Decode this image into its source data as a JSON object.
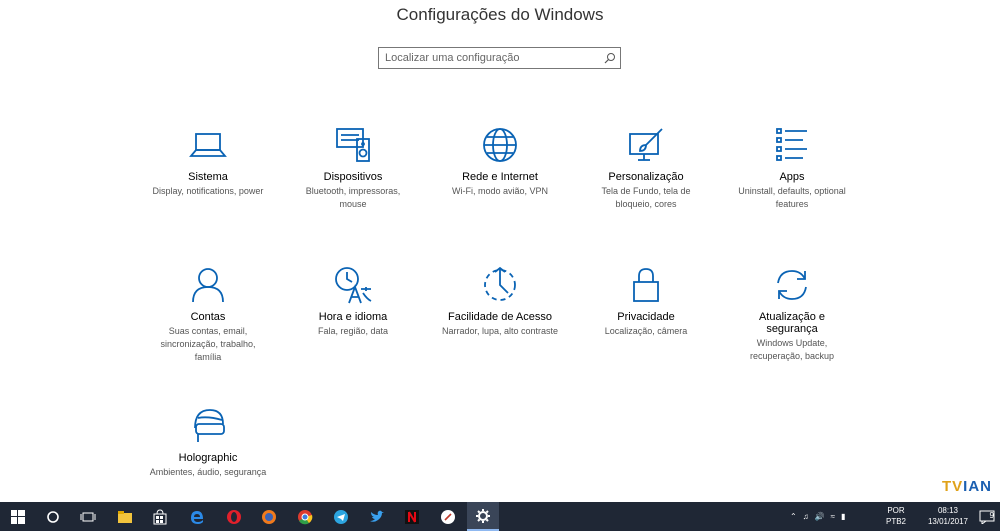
{
  "window": {
    "title": "Configurações do Windows"
  },
  "search": {
    "placeholder": "Localizar uma configuração"
  },
  "tiles": [
    {
      "name": "Sistema",
      "desc": "Display, notifications, power",
      "icon": "laptop-icon"
    },
    {
      "name": "Dispositivos",
      "desc": "Bluetooth, impressoras, mouse",
      "icon": "keyboard-speaker-icon"
    },
    {
      "name": "Rede e Internet",
      "desc": "Wi-Fi, modo avião, VPN",
      "icon": "globe-icon"
    },
    {
      "name": "Personalização",
      "desc": "Tela de Fundo, tela de bloqueio, cores",
      "icon": "paint-brush-icon"
    },
    {
      "name": "Apps",
      "desc": "Uninstall, defaults, optional features",
      "icon": "list-icon"
    },
    {
      "name": "Contas",
      "desc": "Suas contas, email, sincronização, trabalho, família",
      "icon": "person-icon"
    },
    {
      "name": "Hora e idioma",
      "desc": "Fala, região, data",
      "icon": "clock-language-icon"
    },
    {
      "name": "Facilidade de Acesso",
      "desc": "Narrador, lupa, alto contraste",
      "icon": "ease-of-access-icon"
    },
    {
      "name": "Privacidade",
      "desc": "Localização, câmera",
      "icon": "lock-icon"
    },
    {
      "name": "Atualização e segurança",
      "desc": "Windows Update, recuperação, backup",
      "icon": "sync-icon"
    },
    {
      "name": "Holographic",
      "desc": "Ambientes, áudio, segurança",
      "icon": "headset-icon"
    }
  ],
  "watermark": {
    "text_a": "TV",
    "text_b": "IAN"
  },
  "taskbar": {
    "language": "POR",
    "layout": "PTB2",
    "time": "08:13",
    "date": "13/01/2017",
    "notification_count": "9",
    "accent": "#1f2735"
  }
}
